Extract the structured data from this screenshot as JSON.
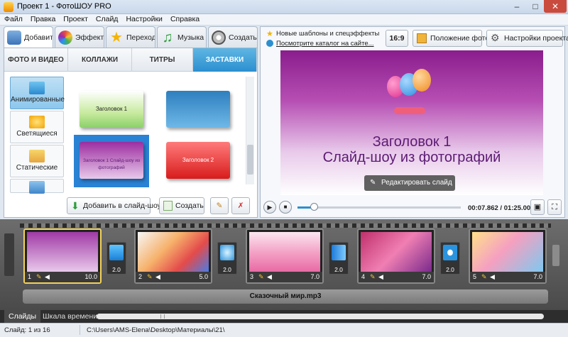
{
  "window": {
    "title": "Проект 1 - ФотоШОУ PRO"
  },
  "menu": [
    "Файл",
    "Правка",
    "Проект",
    "Слайд",
    "Настройки",
    "Справка"
  ],
  "toptabs": [
    "Добавить",
    "Эффекты",
    "Переходы",
    "Музыка",
    "Создать"
  ],
  "subtabs": [
    "ФОТО И ВИДЕО",
    "КОЛЛАЖИ",
    "ТИТРЫ",
    "ЗАСТАВКИ"
  ],
  "categories": [
    "Анимированные",
    "Светящиеся",
    "Статические"
  ],
  "templates": [
    "Заголовок 1",
    "Заголовок 2",
    "Заголовок 1 Слайд-шоу из фотографий"
  ],
  "left_buttons": {
    "add": "Добавить в слайд-шоу",
    "create": "Создать"
  },
  "right": {
    "news": "Новые шаблоны и спецэффекты",
    "catalog_link": "Посмотрите каталог на сайте...",
    "ratio": "16:9",
    "photo_pos": "Положение фото",
    "settings": "Настройки проекта",
    "preview_title": "Заголовок 1",
    "preview_subtitle": "Слайд-шоу из фотографий",
    "edit_button": "Редактировать слайд",
    "time": "00:07.862 / 01:25.000"
  },
  "slides": [
    {
      "num": "1",
      "dur": "10.0"
    },
    {
      "num": "2",
      "dur": "5.0"
    },
    {
      "num": "3",
      "dur": "7.0"
    },
    {
      "num": "4",
      "dur": "7.0"
    },
    {
      "num": "5",
      "dur": "7.0"
    }
  ],
  "transitions": [
    "2.0",
    "2.0",
    "2.0",
    "2.0"
  ],
  "audio": "Сказочный мир.mp3",
  "bottomtabs": [
    "Слайды",
    "Шкала времени"
  ],
  "status": {
    "slide": "Слайд: 1 из 16",
    "path": "C:\\Users\\AMS-Elena\\Desktop\\Материалы\\21\\"
  },
  "colors": {
    "accent": "#2b8fcf",
    "preview_top": "#8a1d8c",
    "timeline": "#4a4a4a",
    "selected": "#f2d35c"
  }
}
